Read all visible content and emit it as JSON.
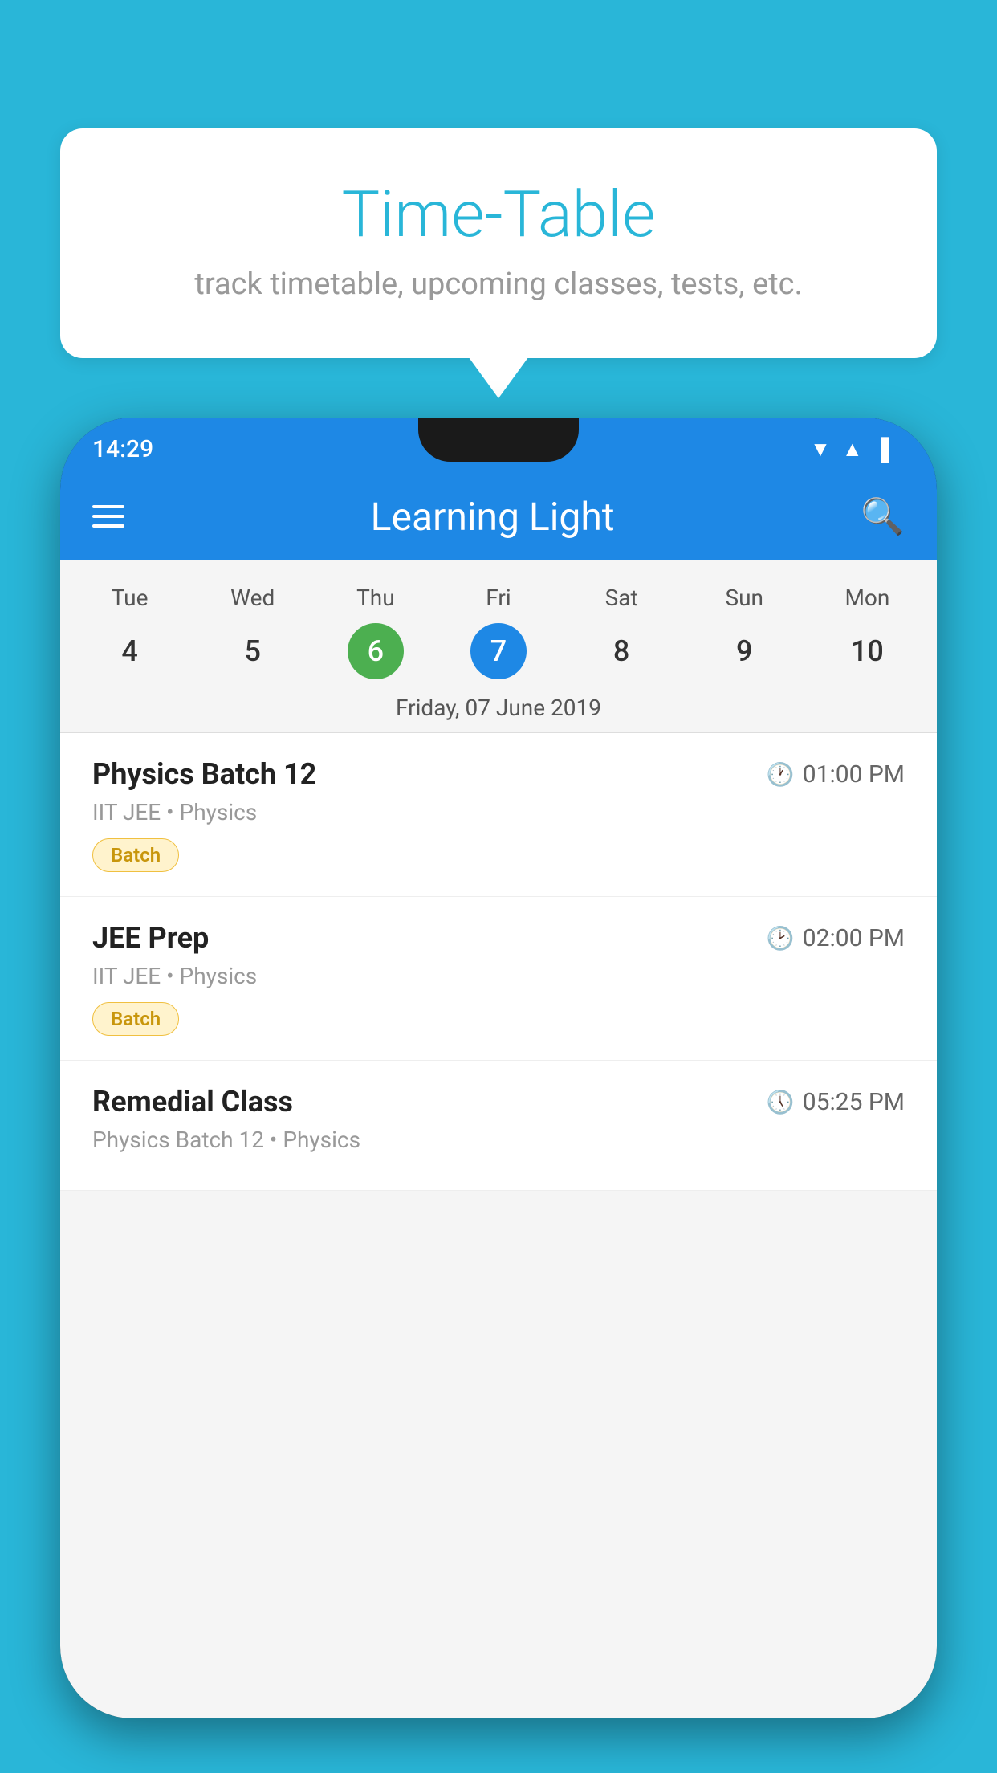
{
  "background_color": "#29B6D8",
  "speech_bubble": {
    "title": "Time-Table",
    "subtitle": "track timetable, upcoming classes, tests, etc."
  },
  "phone": {
    "status_bar": {
      "time": "14:29"
    },
    "app_bar": {
      "title": "Learning Light"
    },
    "calendar": {
      "day_names": [
        "Tue",
        "Wed",
        "Thu",
        "Fri",
        "Sat",
        "Sun",
        "Mon"
      ],
      "day_numbers": [
        "4",
        "5",
        "6",
        "7",
        "8",
        "9",
        "10"
      ],
      "today_index": 2,
      "selected_index": 3,
      "selected_date_label": "Friday, 07 June 2019"
    },
    "classes": [
      {
        "name": "Physics Batch 12",
        "time": "01:00 PM",
        "meta": "IIT JEE • Physics",
        "badge": "Batch"
      },
      {
        "name": "JEE Prep",
        "time": "02:00 PM",
        "meta": "IIT JEE • Physics",
        "badge": "Batch"
      },
      {
        "name": "Remedial Class",
        "time": "05:25 PM",
        "meta": "Physics Batch 12 • Physics",
        "badge": null
      }
    ]
  }
}
